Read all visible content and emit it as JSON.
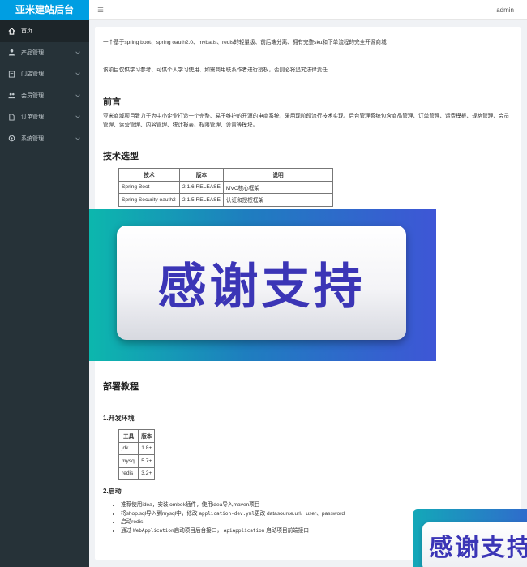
{
  "sidebar": {
    "logo": "亚米建站后台",
    "items": [
      {
        "label": "首页",
        "icon": "home-icon",
        "expandable": false,
        "active": true
      },
      {
        "label": "产品管理",
        "icon": "user-icon",
        "expandable": true
      },
      {
        "label": "门店管理",
        "icon": "file-icon",
        "expandable": true
      },
      {
        "label": "会员管理",
        "icon": "group-icon",
        "expandable": true
      },
      {
        "label": "订单管理",
        "icon": "document-icon",
        "expandable": true
      },
      {
        "label": "系统管理",
        "icon": "gear-icon",
        "expandable": true
      }
    ]
  },
  "header": {
    "user": "admin"
  },
  "content": {
    "intro": "一个基于spring boot、spring oauth2.0、mybatis、redis的轻量级、前后端分离、拥有完整sku和下单流程的完全开源商城",
    "disclaimer": "该项目仅供学习参考、可供个人学习使用、如需商用联系作者进行授权，否则必将追究法律责任",
    "preface_title": "前言",
    "preface_text": "亚米商城项目致力于为中小企业打造一个完整、易于维护的开源的电商系统，采用现阶段流行技术实现。后台管理系统包含商品管理、订单管理、运费模板、规格管理、会员管理、运营管理、内容管理、统计报表、权限管理、设置等模块。",
    "tech_title": "技术选型",
    "tech_table": {
      "headers": [
        "技术",
        "版本",
        "说明"
      ],
      "rows": [
        [
          "Spring Boot",
          "2.1.6.RELEASE",
          "MVC核心框架"
        ],
        [
          "Spring Security oauth2",
          "2.1.5.RELEASE",
          "认证和授权框架"
        ]
      ]
    },
    "deploy_title": "部署教程",
    "env_title": "1.开发环境",
    "env_table": {
      "headers": [
        "工具",
        "版本"
      ],
      "rows": [
        [
          "jdk",
          "1.8+"
        ],
        [
          "mysql",
          "5.7+"
        ],
        [
          "redis",
          "3.2+"
        ]
      ]
    },
    "start_title": "2.启动",
    "start_steps": [
      {
        "pre": "推荐使用idea，安装lombok插件，使用idea导入maven项目",
        "code": "",
        "post": ""
      },
      {
        "pre": "将shop.sql导入到mysql中，修改 ",
        "code": "application-dev.yml",
        "post": "更改 datasource.url、user、password"
      },
      {
        "pre": "启动redis",
        "code": "",
        "post": ""
      },
      {
        "pre": "通过 ",
        "code": "WebApplication",
        "post": "启动项目后台接口， ",
        "code2": "ApiApplication",
        "post2": " 启动项目前端接口"
      }
    ]
  },
  "banner": {
    "text": "感谢支持",
    "text_partial": "感谢支持"
  },
  "colors": {
    "sidebar_bg": "#263238",
    "logo_bg": "#009ee2",
    "banner_text": "#3b35b6"
  }
}
